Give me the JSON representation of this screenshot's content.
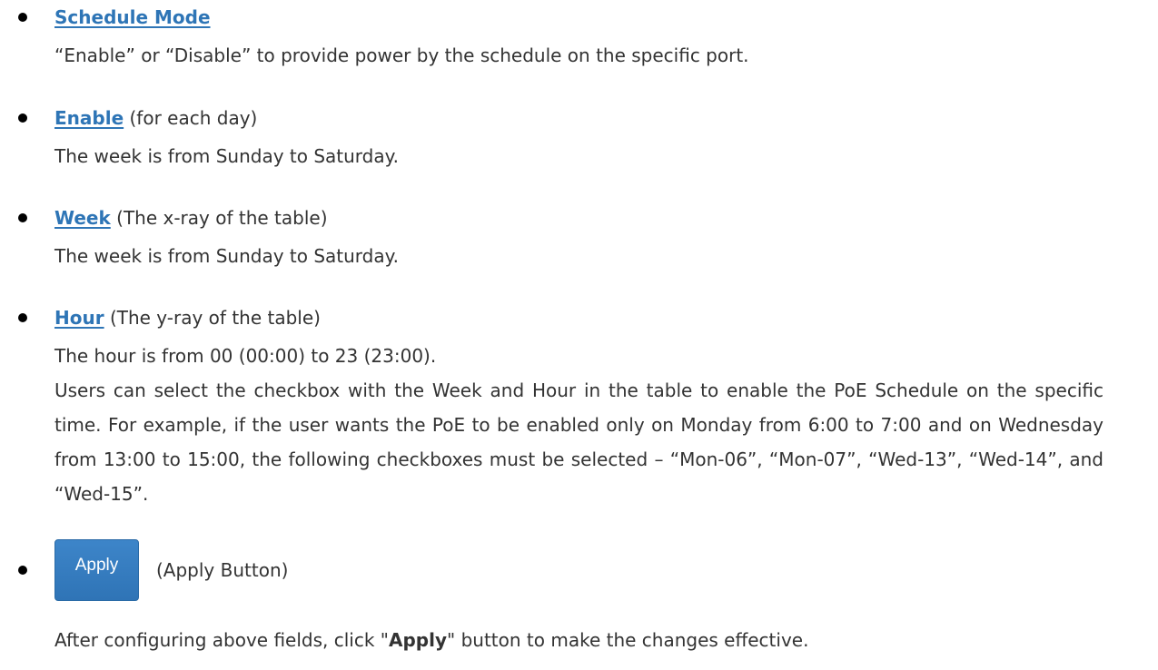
{
  "items": [
    {
      "term": "Schedule Mode",
      "suffix": "",
      "lines": [
        "“Enable” or “Disable” to provide power by the schedule on the specific port."
      ]
    },
    {
      "term": "Enable",
      "suffix": " (for each day)",
      "lines": [
        "The week is from Sunday to Saturday."
      ]
    },
    {
      "term": "Week",
      "suffix": " (The x-ray of the table)",
      "lines": [
        "The week is from Sunday to Saturday."
      ]
    },
    {
      "term": "Hour",
      "suffix": " (The y-ray of the table)",
      "lines": [
        "The hour is from 00 (00:00) to 23 (23:00).",
        "Users can select the checkbox with the Week and Hour in the table to enable the PoE Schedule on the specific time. For example, if the user wants the PoE to be enabled only on Monday from 6:00 to 7:00 and on Wednesday from 13:00 to 15:00, the following checkboxes must be selected – “Mon-06”, “Mon-07”, “Wed-13”, “Wed-14”, and “Wed-15”."
      ]
    }
  ],
  "apply": {
    "button_label": "Apply",
    "caption": "(Apply Button)",
    "note_prefix": "After configuring above fields, click \"",
    "note_bold": "Apply",
    "note_suffix": "\" button to make the changes effective."
  },
  "colors": {
    "term_link": "#2e75b6",
    "button_bg": "#337ab7",
    "body_text": "#333333"
  }
}
